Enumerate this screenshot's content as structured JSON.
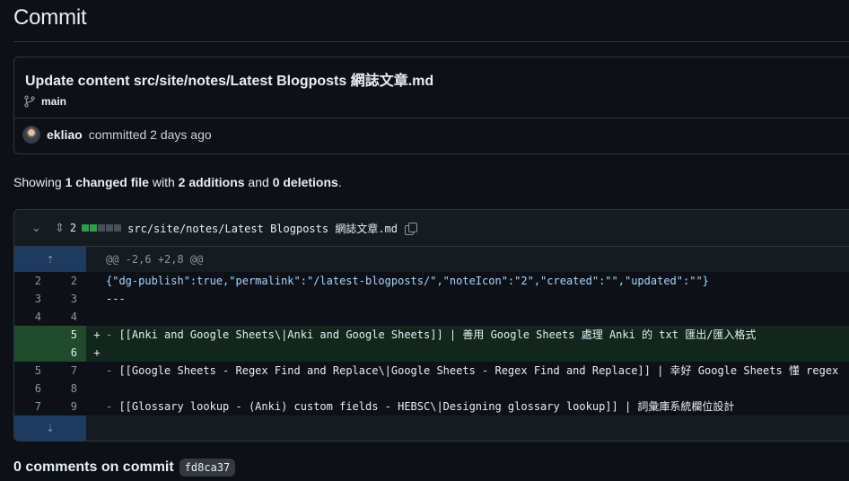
{
  "page": {
    "title": "Commit"
  },
  "commit": {
    "message": "Update content src/site/notes/Latest Blogposts 網誌文章.md",
    "branch": "main",
    "author": "ekliao",
    "action": "committed 2 days ago",
    "sha": "fd8ca37"
  },
  "summary": {
    "prefix": "Showing ",
    "files": "1 changed file",
    "mid1": " with ",
    "additions": "2 additions",
    "mid2": " and ",
    "deletions": "0 deletions",
    "suffix": "."
  },
  "file": {
    "count": "2",
    "path": "src/site/notes/Latest Blogposts 網誌文章.md",
    "diffstat": [
      "add",
      "add",
      "neutral",
      "neutral",
      "neutral"
    ],
    "hunk": "@@ -2,6 +2,8 @@",
    "lines": [
      {
        "type": "ctx",
        "old": "2",
        "new": "2",
        "sign": "",
        "text": "{\"dg-publish\":true,\"permalink\":\"/latest-blogposts/\",\"noteIcon\":\"2\",\"created\":\"\",\"updated\":\"\"}"
      },
      {
        "type": "ctx",
        "old": "3",
        "new": "3",
        "sign": "",
        "text": "---"
      },
      {
        "type": "ctx",
        "old": "4",
        "new": "4",
        "sign": "",
        "text": ""
      },
      {
        "type": "add",
        "old": "",
        "new": "5",
        "sign": "+",
        "dash": "- ",
        "text": "[[Anki and Google Sheets\\|Anki and Google Sheets]] | 善用 Google Sheets 處理 Anki 的 txt 匯出/匯入格式"
      },
      {
        "type": "add",
        "old": "",
        "new": "6",
        "sign": "+",
        "text": ""
      },
      {
        "type": "ctx",
        "old": "5",
        "new": "7",
        "sign": "",
        "dash": "- ",
        "text": "[[Google Sheets - Regex Find and Replace\\|Google Sheets - Regex Find and Replace]] | 幸好 Google Sheets 懂 regex"
      },
      {
        "type": "ctx",
        "old": "6",
        "new": "8",
        "sign": "",
        "text": ""
      },
      {
        "type": "ctx",
        "old": "7",
        "new": "9",
        "sign": "",
        "dash": "- ",
        "text": "[[Glossary lookup - (Anki) custom fields - HEBSC\\|Designing glossary lookup]] | 詞彙庫系統欄位設計"
      }
    ]
  },
  "comments": {
    "title": "0 comments on commit"
  },
  "icons": {
    "branch": "git-branch-icon",
    "chevron": "chevron-down-icon",
    "expand": "unfold-icon",
    "copy": "copy-icon",
    "expand_up": "expand-up-icon",
    "expand_down": "expand-down-icon"
  },
  "colors": {
    "background": "#0d1117",
    "addition_bg": "#12261e",
    "addition_gutter": "#1f4a2c",
    "hunk_gutter": "#1f3a5f",
    "diff_added_square": "#2ea043"
  }
}
